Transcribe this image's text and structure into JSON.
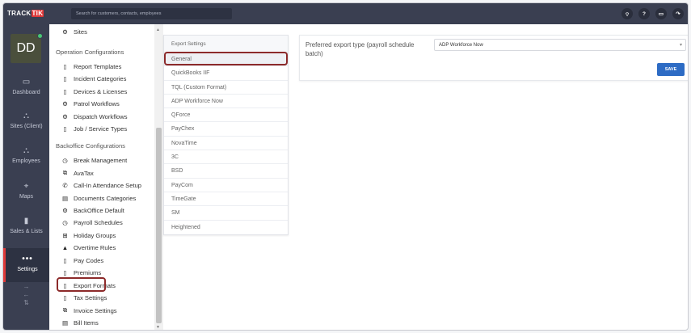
{
  "topbar": {
    "logo_part1": "TRACK",
    "logo_part2": "TIK",
    "search_placeholder": "Search for customers, contacts, employees",
    "icons": [
      {
        "name": "signal-icon",
        "glyph": "⌔"
      },
      {
        "name": "help-icon",
        "glyph": "?"
      },
      {
        "name": "chat-icon",
        "glyph": "▭"
      },
      {
        "name": "share-icon",
        "glyph": "↷"
      }
    ]
  },
  "user": {
    "initials": "DD",
    "status_color": "#48c774"
  },
  "leftnav": {
    "items": [
      {
        "label": "Dashboard",
        "icon": "monitor-icon",
        "glyph": "▭"
      },
      {
        "label": "Sites (Client)",
        "icon": "sites-icon",
        "glyph": "⛬"
      },
      {
        "label": "Employees",
        "icon": "employees-icon",
        "glyph": "⛬"
      },
      {
        "label": "Maps",
        "icon": "map-icon",
        "glyph": "⌖"
      },
      {
        "label": "Sales & Lists",
        "icon": "chart-icon",
        "glyph": "▮"
      },
      {
        "label": "Settings",
        "icon": "dots-icon",
        "glyph": "•••"
      }
    ],
    "arrows": [
      "→",
      "←",
      "⇅"
    ]
  },
  "settings": {
    "top_item": {
      "label": "Sites",
      "icon": "gear-icon",
      "glyph": "⚙"
    },
    "operation_title": "Operation Configurations",
    "operation_items": [
      {
        "label": "Report Templates",
        "icon": "document-icon",
        "glyph": "▯"
      },
      {
        "label": "Incident Categories",
        "icon": "document-icon",
        "glyph": "▯"
      },
      {
        "label": "Devices & Licenses",
        "icon": "mobile-icon",
        "glyph": "▯"
      },
      {
        "label": "Patrol Workflows",
        "icon": "workflow-icon",
        "glyph": "⚙"
      },
      {
        "label": "Dispatch Workflows",
        "icon": "workflow-icon",
        "glyph": "⚙"
      },
      {
        "label": "Job / Service Types",
        "icon": "document-icon",
        "glyph": "▯"
      }
    ],
    "backoffice_title": "Backoffice Configurations",
    "backoffice_items": [
      {
        "label": "Break Management",
        "icon": "clock-icon",
        "glyph": "◷"
      },
      {
        "label": "AvaTax",
        "icon": "copy-icon",
        "glyph": "⧉"
      },
      {
        "label": "Call-In Attendance Setup",
        "icon": "phone-icon",
        "glyph": "✆"
      },
      {
        "label": "Documents Categories",
        "icon": "documents-icon",
        "glyph": "▤"
      },
      {
        "label": "BackOffice Default",
        "icon": "gear-icon",
        "glyph": "⚙"
      },
      {
        "label": "Payroll Schedules",
        "icon": "clock-icon",
        "glyph": "◷"
      },
      {
        "label": "Holiday Groups",
        "icon": "gift-icon",
        "glyph": "⊞"
      },
      {
        "label": "Overtime Rules",
        "icon": "warning-icon",
        "glyph": "▲"
      },
      {
        "label": "Pay Codes",
        "icon": "document-icon",
        "glyph": "▯"
      },
      {
        "label": "Premiums",
        "icon": "document-icon",
        "glyph": "▯"
      },
      {
        "label": "Export Formats",
        "icon": "document-icon",
        "glyph": "▯"
      },
      {
        "label": "Tax Settings",
        "icon": "document-icon",
        "glyph": "▯"
      },
      {
        "label": "Invoice Settings",
        "icon": "copy-icon",
        "glyph": "⧉"
      },
      {
        "label": "Bill Items",
        "icon": "list-icon",
        "glyph": "▤"
      }
    ]
  },
  "export_settings": {
    "header": "Export Settings",
    "items": [
      "General",
      "QuickBooks IIF",
      "TQL (Custom Format)",
      "ADP Workforce Now",
      "QForce",
      "PayChex",
      "NovaTime",
      "3C",
      "BSD",
      "PayCom",
      "TimeGate",
      "SM",
      "Heightened"
    ],
    "selected_index": 0
  },
  "preferences": {
    "label": "Preferred export type (payroll schedule batch)",
    "selected_value": "ADP Workforce Now",
    "save_label": "SAVE"
  },
  "colors": {
    "topbar": "#3a3f51",
    "accent_red": "#e03a3a",
    "highlight": "#8c2a2a",
    "save_button": "#2d6bc4"
  }
}
